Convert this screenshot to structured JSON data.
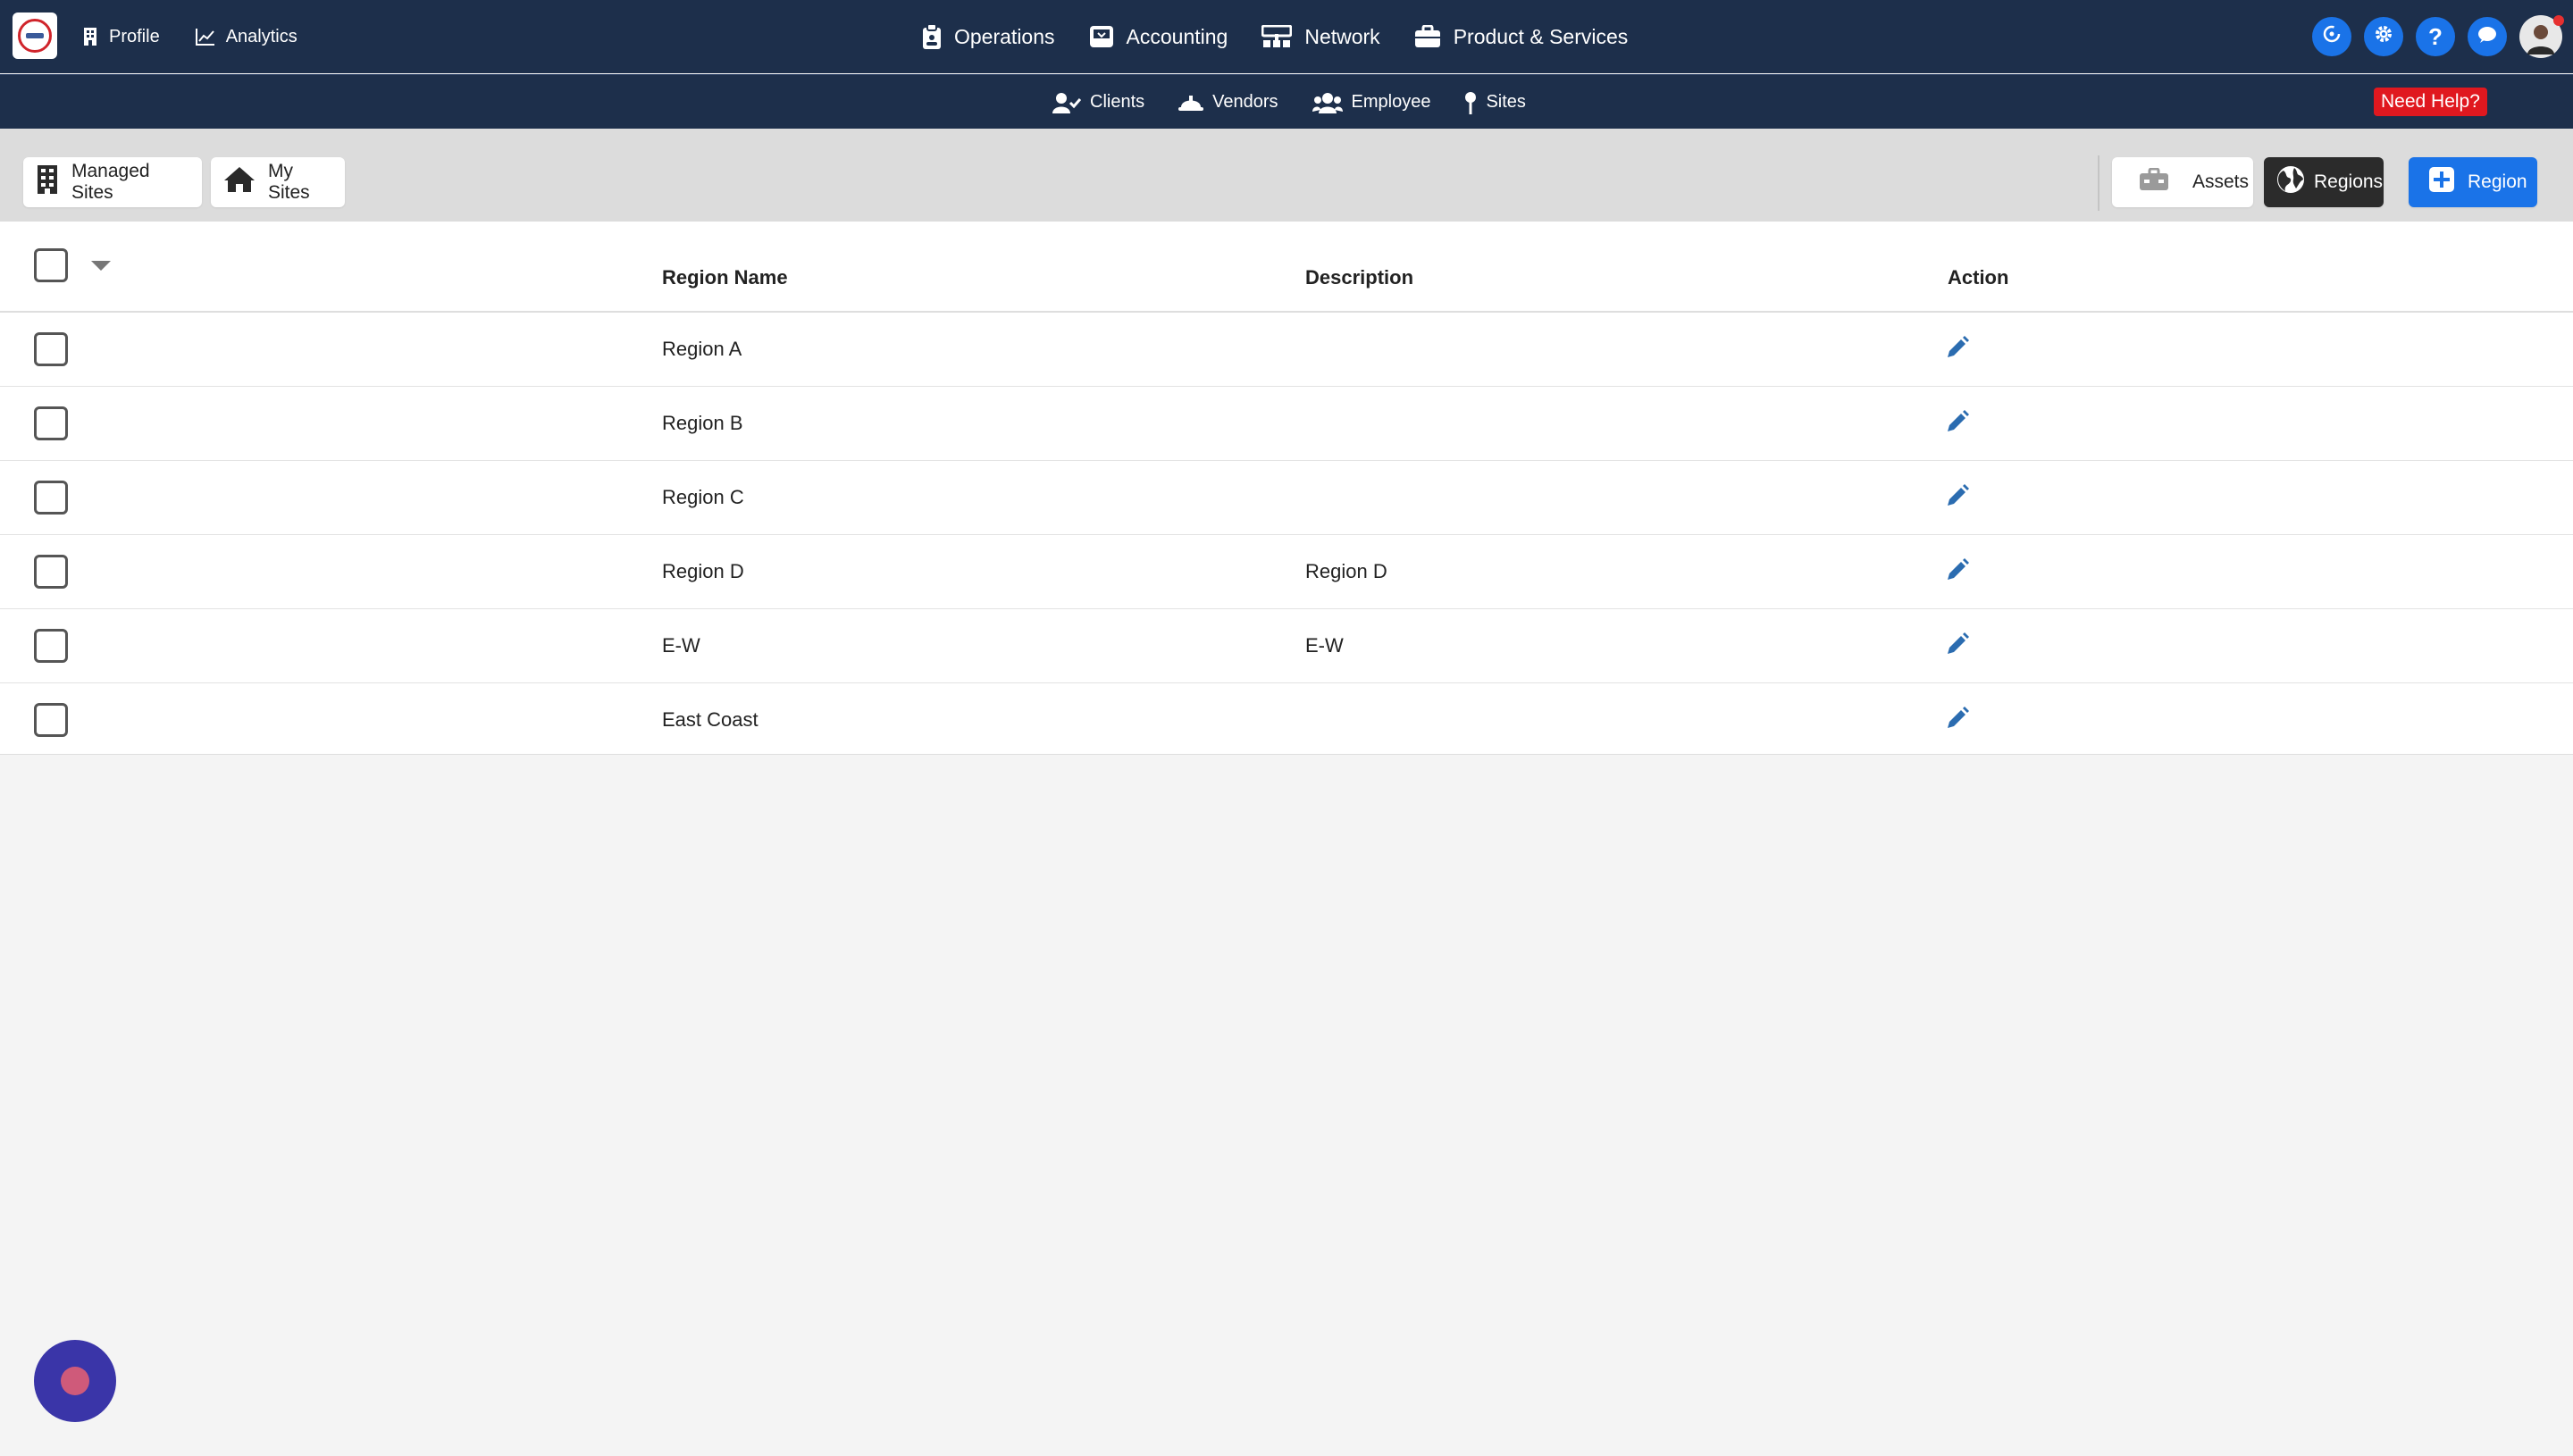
{
  "topnav": {
    "left": [
      {
        "label": "Profile",
        "icon": "building-icon"
      },
      {
        "label": "Analytics",
        "icon": "chart-line-icon"
      }
    ],
    "center": [
      {
        "label": "Operations",
        "icon": "clipboard-icon"
      },
      {
        "label": "Accounting",
        "icon": "inbox-icon"
      },
      {
        "label": "Network",
        "icon": "network-icon"
      },
      {
        "label": "Product & Services",
        "icon": "briefcase-icon"
      }
    ],
    "right_icons": [
      "sync-icon",
      "gear-icon",
      "question-icon",
      "chat-icon",
      "user-avatar"
    ]
  },
  "subnav": {
    "items": [
      {
        "label": "Clients",
        "icon": "user-check-icon"
      },
      {
        "label": "Vendors",
        "icon": "hardhat-icon"
      },
      {
        "label": "Employee",
        "icon": "users-icon"
      },
      {
        "label": "Sites",
        "icon": "pin-icon"
      }
    ],
    "help_label": "Need Help?"
  },
  "toolbar": {
    "managed_sites": "Managed Sites",
    "my_sites": "My Sites",
    "assets": "Assets",
    "regions": "Regions",
    "add_region": "Region"
  },
  "table": {
    "columns": [
      "Region Name",
      "Description",
      "Action"
    ],
    "rows": [
      {
        "name": "Region A",
        "description": ""
      },
      {
        "name": "Region B",
        "description": ""
      },
      {
        "name": "Region C",
        "description": ""
      },
      {
        "name": "Region D",
        "description": "Region D"
      },
      {
        "name": "E-W",
        "description": "E-W"
      },
      {
        "name": "East Coast",
        "description": ""
      }
    ]
  },
  "colors": {
    "nav_bg": "#1d2f4b",
    "accent_blue": "#1a73e8",
    "help_red": "#e0181f",
    "edit_icon": "#2b6cb0"
  }
}
